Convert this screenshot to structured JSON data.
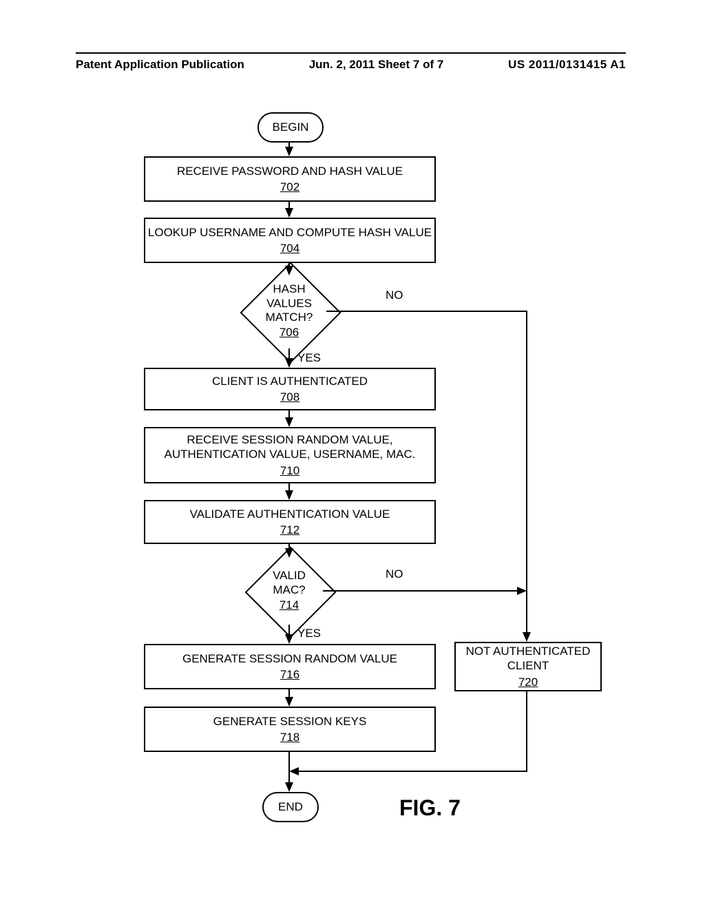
{
  "header": {
    "left": "Patent Application Publication",
    "mid": "Jun. 2, 2011  Sheet 7 of 7",
    "right": "US 2011/0131415 A1"
  },
  "figure_label": "FIG. 7",
  "terminator": {
    "begin": "BEGIN",
    "end": "END"
  },
  "steps": {
    "s702": {
      "text": "RECEIVE PASSWORD AND HASH VALUE",
      "ref": "702"
    },
    "s704": {
      "text": "LOOKUP USERNAME AND COMPUTE HASH VALUE",
      "ref": "704"
    },
    "s706": {
      "text": "HASH VALUES MATCH?",
      "ref": "706"
    },
    "s708": {
      "text": "CLIENT IS AUTHENTICATED",
      "ref": "708"
    },
    "s710": {
      "text": "RECEIVE SESSION RANDOM VALUE, AUTHENTICATION VALUE, USERNAME, MAC.",
      "ref": "710"
    },
    "s712": {
      "text": "VALIDATE AUTHENTICATION VALUE",
      "ref": "712"
    },
    "s714": {
      "text": "VALID MAC?",
      "ref": "714"
    },
    "s716": {
      "text": "GENERATE SESSION RANDOM VALUE",
      "ref": "716"
    },
    "s718": {
      "text": "GENERATE SESSION KEYS",
      "ref": "718"
    },
    "s720": {
      "text": "NOT AUTHENTICATED CLIENT",
      "ref": "720"
    }
  },
  "labels": {
    "yes": "YES",
    "no": "NO"
  }
}
